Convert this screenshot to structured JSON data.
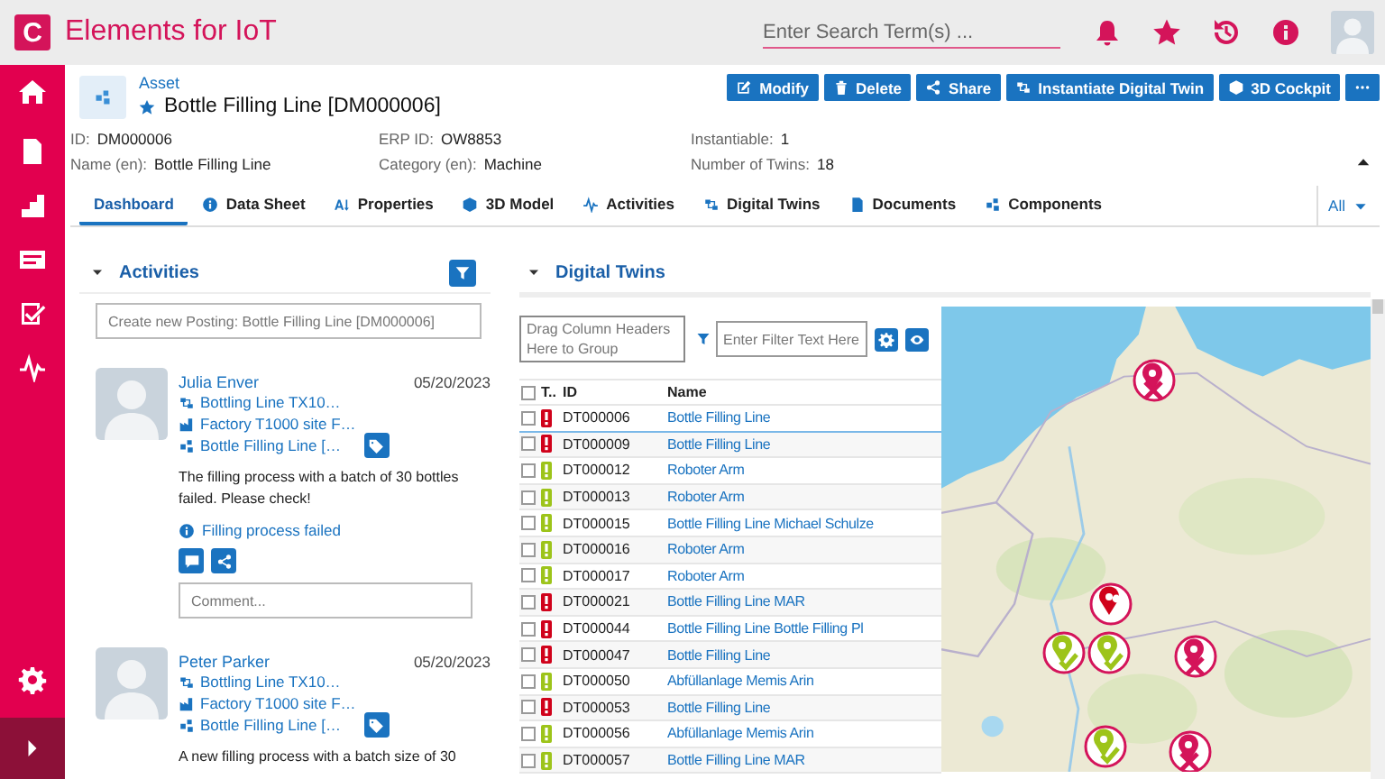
{
  "app": {
    "logo": "C",
    "title": "Elements for IoT",
    "search": {
      "placeholder": "Enter Search Term(s) ..."
    }
  },
  "asset": {
    "type": "Asset",
    "title": "Bottle Filling Line [DM000006]",
    "actions": [
      {
        "kind": "edit",
        "label": "Modify"
      },
      {
        "kind": "delete",
        "label": "Delete"
      },
      {
        "kind": "share",
        "label": "Share"
      },
      {
        "kind": "instantiate",
        "label": "Instantiate Digital Twin"
      },
      {
        "kind": "cockpit",
        "label": "3D Cockpit"
      }
    ],
    "fields": [
      {
        "label": "ID:",
        "value": "DM000006"
      },
      {
        "label": "ERP ID:",
        "value": "OW8853"
      },
      {
        "label": "Instantiable:",
        "value": "1"
      },
      {
        "label": "Name (en):",
        "value": "Bottle Filling Line"
      },
      {
        "label": "Category (en):",
        "value": "Machine"
      },
      {
        "label": "Number of Twins:",
        "value": "18"
      }
    ]
  },
  "tabs": [
    {
      "kind": "dashboard",
      "label": "Dashboard",
      "selected": true
    },
    {
      "kind": "datasheet",
      "label": "Data Sheet",
      "selected": false
    },
    {
      "kind": "properties",
      "label": "Properties",
      "selected": false
    },
    {
      "kind": "model",
      "label": "3D Model",
      "selected": false
    },
    {
      "kind": "activities",
      "label": "Activities",
      "selected": false
    },
    {
      "kind": "twins",
      "label": "Digital Twins",
      "selected": false
    },
    {
      "kind": "documents",
      "label": "Documents",
      "selected": false
    },
    {
      "kind": "components",
      "label": "Components",
      "selected": false
    }
  ],
  "tab_filter": "All",
  "activities": {
    "title": "Activities",
    "posting_placeholder": "Create new Posting: Bottle Filling Line [DM000006]",
    "posts": [
      {
        "author": "Julia Enver",
        "date": "05/20/2023",
        "links": [
          {
            "kind": "twin",
            "label": "Bottling Line TX10…"
          },
          {
            "kind": "factory",
            "label": "Factory T1000 site F…"
          },
          {
            "kind": "asset",
            "label": "Bottle Filling Line […"
          }
        ],
        "text": "The filling process with a batch of 30 bottles failed. Please check!",
        "event": "Filling process failed",
        "comment_placeholder": "Comment..."
      },
      {
        "author": "Peter Parker",
        "date": "05/20/2023",
        "links": [
          {
            "kind": "twin",
            "label": "Bottling Line TX10…"
          },
          {
            "kind": "factory",
            "label": "Factory T1000 site F…"
          },
          {
            "kind": "asset",
            "label": "Bottle Filling Line […"
          }
        ],
        "text": "A new filling process with a batch size of 30"
      }
    ]
  },
  "twins": {
    "title": "Digital Twins",
    "group_hint": "Drag Column Headers Here to Group",
    "filter_placeholder": "Enter Filter Text Here",
    "columns": [
      "T..",
      "ID",
      "Name"
    ],
    "select_all_checked": false,
    "rows": [
      {
        "id": "DT000006",
        "name": "Bottle Filling Line",
        "color": "#d0021b",
        "checked": false,
        "selected": true
      },
      {
        "id": "DT000009",
        "name": "Bottle Filling Line",
        "color": "#d0021b",
        "checked": false,
        "selected": false
      },
      {
        "id": "DT000012",
        "name": "Roboter Arm",
        "color": "#9dc41a",
        "checked": false,
        "selected": false
      },
      {
        "id": "DT000013",
        "name": "Roboter Arm",
        "color": "#9dc41a",
        "checked": false,
        "selected": false
      },
      {
        "id": "DT000015",
        "name": "Bottle Filling Line Michael Schulze",
        "color": "#9dc41a",
        "checked": false,
        "selected": false
      },
      {
        "id": "DT000016",
        "name": "Roboter Arm",
        "color": "#9dc41a",
        "checked": false,
        "selected": false
      },
      {
        "id": "DT000017",
        "name": "Roboter Arm",
        "color": "#9dc41a",
        "checked": false,
        "selected": false
      },
      {
        "id": "DT000021",
        "name": "Bottle Filling Line MAR",
        "color": "#d0021b",
        "checked": false,
        "selected": false
      },
      {
        "id": "DT000044",
        "name": "Bottle Filling Line Bottle Filling Pl",
        "color": "#d0021b",
        "checked": false,
        "selected": false
      },
      {
        "id": "DT000047",
        "name": "Bottle Filling Line",
        "color": "#d0021b",
        "checked": false,
        "selected": false
      },
      {
        "id": "DT000050",
        "name": "Abfüllanlage Memis Arin",
        "color": "#9dc41a",
        "checked": false,
        "selected": false
      },
      {
        "id": "DT000053",
        "name": "Bottle Filling Line",
        "color": "#d0021b",
        "checked": false,
        "selected": false
      },
      {
        "id": "DT000056",
        "name": "Abfüllanlage Memis Arin",
        "color": "#9dc41a",
        "checked": false,
        "selected": false
      },
      {
        "id": "DT000057",
        "name": "Bottle Filling Line MAR",
        "color": "#9dc41a",
        "checked": false,
        "selected": false
      }
    ],
    "map": {
      "kind": "picture",
      "markers": [
        {
          "kind": "error"
        },
        {
          "kind": "alert"
        },
        {
          "kind": "ok"
        },
        {
          "kind": "ok"
        },
        {
          "kind": "error"
        },
        {
          "kind": "ok"
        },
        {
          "kind": "error"
        }
      ]
    }
  }
}
